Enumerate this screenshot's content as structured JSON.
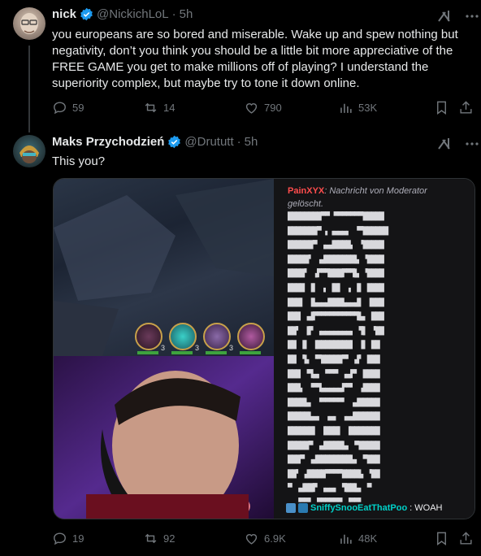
{
  "posts": [
    {
      "name": "nick",
      "handle": "@NickichLoL",
      "sep": "·",
      "time": "5h",
      "text": "you europeans are so bored and miserable. Wake up and spew nothing but negativity, don’t you think you should be a little bit more appreciative of the FREE GAME you get to make millions off of playing? I understand the superiority complex, but maybe try to tone it down online.",
      "replies": "59",
      "reposts": "14",
      "likes": "790",
      "views": "53K"
    },
    {
      "name": "Maks Przychodzień",
      "handle": "@Drututt",
      "sep": "·",
      "time": "5h",
      "text": "This you?",
      "replies": "19",
      "reposts": "92",
      "likes": "6.9K",
      "views": "48K"
    }
  ],
  "media": {
    "chat_user": "PainXYX",
    "chat_notice": ": Nachricht von Moderator",
    "chat_deleted": "gelöscht.",
    "ascii_lines": [
      "████████▀▀ ▀▀▀▀▀▀▀█████",
      "███████▀ ▖▗▄▄▄▖ ▝▀██████",
      "██████▀ ▗▄▟████▖ ▝█████",
      "█████▘ ▗▟███████▙ ▝████",
      "████▘ ▗▛▀▜███▛▀▜▙ ▝████",
      "████ ▐▌ ▗ ▐█▌ ▗ ▐▌ ████",
      "███▌ ▐▙▄▄▟███▙▄▄▟▌ ▐███",
      "███ ▗▟▛▀▀▀▀▀▀▀▀▀▜▙▖ ███",
      "██▘ ▐▛ ▗▄▄▄▄▄▄▄▖ ▜▌ ▝██",
      "██ ▐▌ ▐████████▌ ▐▌ ██",
      "██ ▝▙ ▝▀█████▀▘ ▟▘ ███",
      "███ ▝▜▄▖ ▀▀▀ ▗▄▛▘ ████",
      "███▖ ▝▀▜▄▄▄▄▄▛▀▘ ▗████",
      "████▙▖ ▝▀▀▀▀▀▘ ▗▟█████",
      "█████▙▄▖ ▗▄▖ ▗▄▟██████",
      "██████▌ ▐███▌ ▐███████",
      "█████▀ ▗▟████▙▖ ▀█████",
      "███▀ ▗▟████████▙▖ ▀███",
      "██▘ ▟████▀▀▀▀████▙ ▝██",
      "▀ ▗▟██▛ ▗▄▄▖ ▜██▙▖ ▀",
      "  ▝▀▀▘ ▀▀▀▀▀▀ ▝▀▀▘   "
    ],
    "chat_user2": "SniffySnooEatThatPoo",
    "chat_msg2": ": WOAH",
    "champ_levels": [
      "3",
      "3",
      "3",
      ""
    ]
  },
  "colors": {
    "verified": "#1d9bf0",
    "chat_user": "#ff4d4d",
    "chat_user2": "#00d1c8"
  },
  "icons": [
    "reply-icon",
    "repost-icon",
    "like-icon",
    "views-icon",
    "bookmark-icon",
    "share-icon",
    "grok-icon",
    "more-icon"
  ]
}
